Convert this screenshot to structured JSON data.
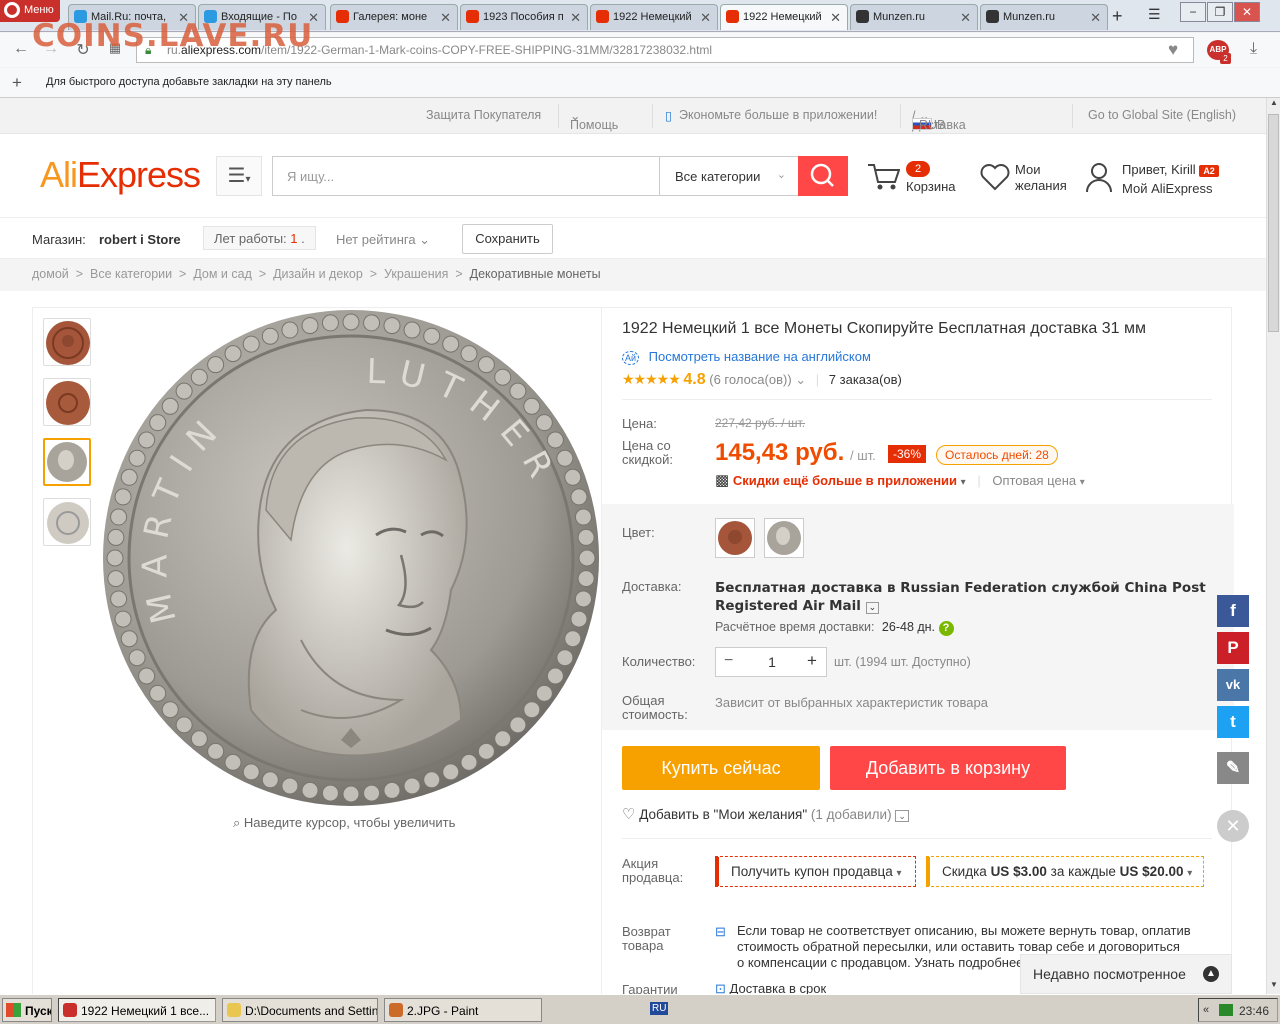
{
  "browser": {
    "menu_label": "Меню",
    "tabs": [
      {
        "label": "Mail.Ru: почта,",
        "color": "#2b9ae0"
      },
      {
        "label": "Входящие - По",
        "color": "#2b9ae0"
      },
      {
        "label": "Галерея: моне",
        "color": "#e62e04"
      },
      {
        "label": "1923 Пособия п",
        "color": "#e62e04"
      },
      {
        "label": "1922 Немецкий",
        "color": "#e62e04"
      },
      {
        "label": "1922 Немецкий",
        "color": "#e62e04"
      },
      {
        "label": "Munzen.ru",
        "color": "#333333"
      },
      {
        "label": "Munzen.ru",
        "color": "#333333"
      }
    ],
    "url_prefix": "ru.",
    "url_host": "aliexpress.com",
    "url_path": "/item/1922-German-1-Mark-coins-COPY-FREE-SHIPPING-31MM/32817238032.html",
    "watermark": "COINS.LAVE.RU",
    "adblock_badge": "ABP",
    "adblock_count": "2",
    "bookmarks_hint": "Для быстрого доступа добавьте закладки на эту панель"
  },
  "topstrip": {
    "buyer_protection": "Защита Покупателя",
    "help": "Помощь",
    "app_promo": "Экономьте больше в приложении!",
    "ship_to": "Доставка в",
    "currency": "RUB",
    "global_site": "Go to Global Site (English)"
  },
  "header": {
    "logo_ali": "Ali",
    "logo_express": "Express",
    "search_placeholder": "Я ищу...",
    "category_select": "Все категории",
    "cart_count": "2",
    "cart_label": "Корзина",
    "wishlist_line1": "Мои",
    "wishlist_line2": "желания",
    "greeting": "Привет, Kirill",
    "user_badge": "A2",
    "my_ali": "Мой AliExpress"
  },
  "store": {
    "label": "Магазин:",
    "name": "robert i Store",
    "years_label": "Лет работы:",
    "years_value": "1",
    "rating": "Нет рейтинга",
    "save_button": "Сохранить"
  },
  "breadcrumbs": [
    "домой",
    "Все категории",
    "Дом и сад",
    "Дизайн и декор",
    "Украшения",
    "Декоративные монеты"
  ],
  "gallery": {
    "zoom_hint": "Наведите курсор, чтобы увеличить",
    "coin_legend": "MARTIN LUTHER"
  },
  "product": {
    "title": "1922 Немецкий 1 все Монеты Скопируйте Бесплатная доставка 31 мм",
    "translate_link": "Посмотреть название на английском",
    "rating_value": "4.8",
    "rating_stars": 4.8,
    "votes": "(6 голоса(ов))",
    "orders": "7 заказа(ов)",
    "price_label": "Цена:",
    "old_price": "227,42 руб. / шт.",
    "discount_price_label_1": "Цена со",
    "discount_price_label_2": "скидкой:",
    "price": "145,43 руб.",
    "price_unit": "/ шт.",
    "discount_badge": "-36%",
    "days_left": "Осталось дней: 28",
    "app_discount": "Скидки ещё больше в приложении",
    "wholesale": "Оптовая цена",
    "color_label": "Цвет:",
    "shipping_label": "Доставка:",
    "shipping_text": "Бесплатная доставка в Russian Federation службой China Post Registered Air Mail",
    "delivery_time_label": "Расчётное время доставки:",
    "delivery_time": "26-48 дн.",
    "qty_label": "Количество:",
    "qty_value": "1",
    "qty_available": "шт. (1994 шт. Доступно)",
    "total_label_1": "Общая",
    "total_label_2": "стоимость:",
    "total_text": "Зависит от выбранных характеристик товара",
    "buy_now": "Купить сейчас",
    "add_to_cart": "Добавить в корзину",
    "wishlist": "Добавить в \"Мои желания\"",
    "wishlist_count": "(1 добавили)",
    "promo_label_1": "Акция",
    "promo_label_2": "продавца:",
    "coupon": "Получить купон продавца",
    "discount_prefix": "Скидка",
    "discount_amount": "US $3.00",
    "discount_mid": "за каждые",
    "discount_threshold": "US $20.00",
    "return_label_1": "Возврат",
    "return_label_2": "товара",
    "return_text_1": "Если товар не соответствует описанию, вы можете вернуть товар, оплатив",
    "return_text_2": "стоимость обратной пересылки, или оставить товар себе и договориться",
    "return_text_3": "о компенсации с продавцом. Узнать подробнее",
    "guarantee_label": "Гарантии",
    "guarantee_text": "Доставка в срок"
  },
  "recently_viewed": "Недавно посмотренное",
  "taskbar": {
    "start": "Пуск",
    "items": [
      "1922 Немецкий 1 все...",
      "D:\\Documents and Settin...",
      "2.JPG - Paint"
    ],
    "lang": "RU",
    "time": "23:46"
  }
}
